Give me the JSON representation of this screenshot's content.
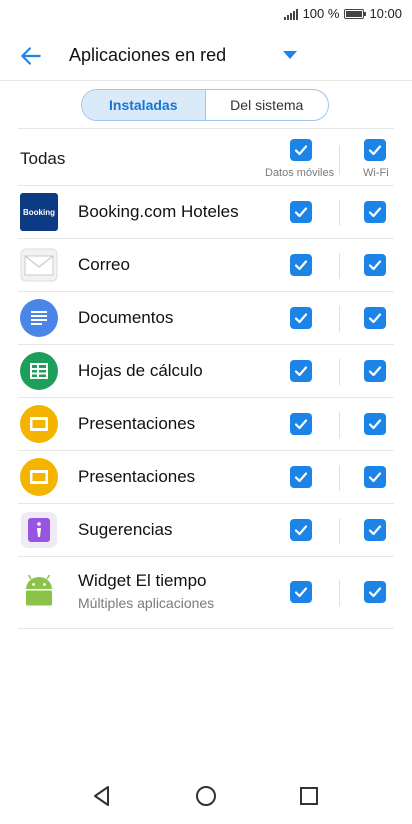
{
  "status": {
    "battery": "100 %",
    "time": "10:00"
  },
  "header": {
    "title": "Aplicaciones en red"
  },
  "tabs": [
    {
      "label": "Instaladas",
      "active": true
    },
    {
      "label": "Del sistema",
      "active": false
    }
  ],
  "columns": {
    "all_label": "Todas",
    "mobile_data": "Datos móviles",
    "wifi": "Wi-Fi"
  },
  "apps": [
    {
      "name": "Booking.com Hoteles",
      "icon": "booking-icon",
      "icon_text": "Booking",
      "data": true,
      "wifi": true
    },
    {
      "name": "Correo",
      "icon": "mail-icon",
      "data": true,
      "wifi": true
    },
    {
      "name": "Documentos",
      "icon": "docs-icon",
      "data": true,
      "wifi": true
    },
    {
      "name": "Hojas de cálculo",
      "icon": "sheets-icon",
      "data": true,
      "wifi": true
    },
    {
      "name": "Presentaciones",
      "icon": "slides-icon",
      "data": true,
      "wifi": true
    },
    {
      "name": "Presentaciones",
      "icon": "slides-icon",
      "data": true,
      "wifi": true
    },
    {
      "name": "Sugerencias",
      "icon": "tips-icon",
      "data": true,
      "wifi": true
    },
    {
      "name": "Widget El tiempo",
      "subtitle": "Múltiples aplicaciones",
      "icon": "android-icon",
      "data": true,
      "wifi": true
    }
  ],
  "colors": {
    "accent": "#1c84e6",
    "segment_active_bg": "#dbeaf9",
    "segment_border": "#9ec6ee"
  }
}
